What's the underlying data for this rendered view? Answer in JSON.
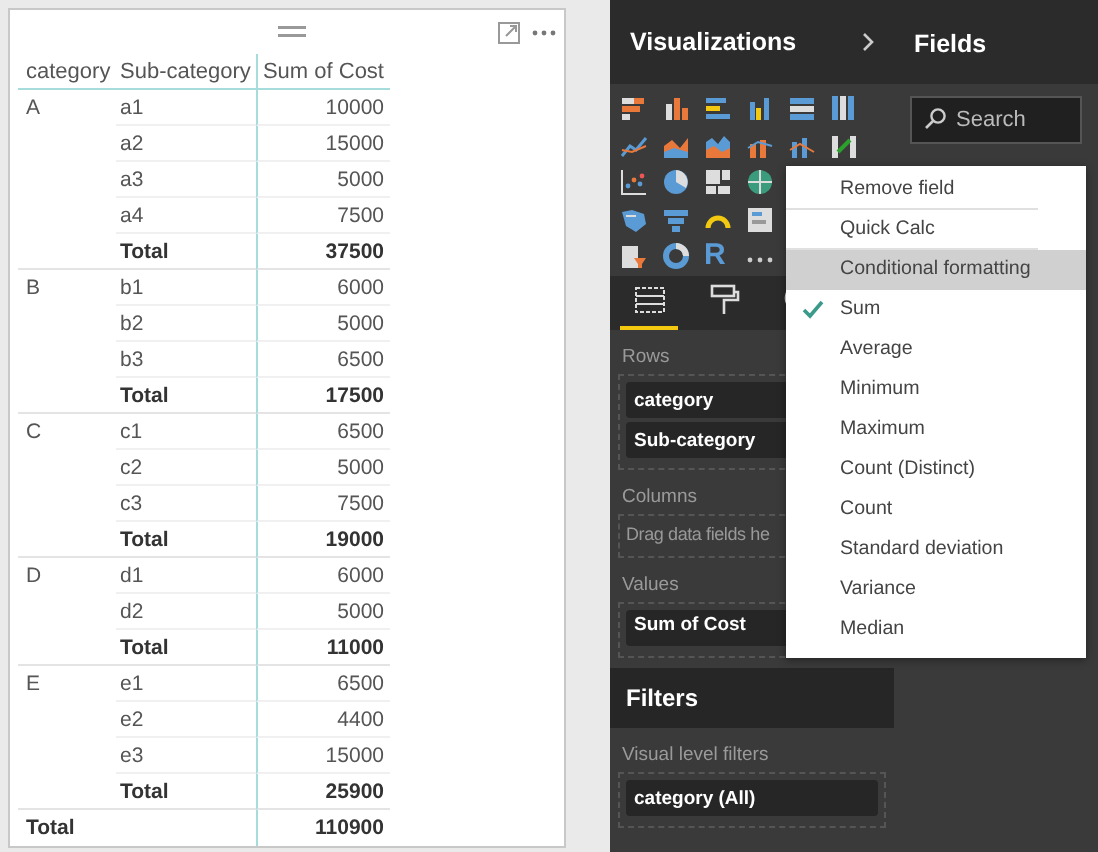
{
  "visual": {
    "columns": [
      "category",
      "Sub-category",
      "Sum of Cost"
    ],
    "groups": [
      {
        "category": "A",
        "rows": [
          {
            "sub": "a1",
            "value": "10000"
          },
          {
            "sub": "a2",
            "value": "15000"
          },
          {
            "sub": "a3",
            "value": "5000"
          },
          {
            "sub": "a4",
            "value": "7500"
          }
        ],
        "total_label": "Total",
        "total": "37500"
      },
      {
        "category": "B",
        "rows": [
          {
            "sub": "b1",
            "value": "6000"
          },
          {
            "sub": "b2",
            "value": "5000"
          },
          {
            "sub": "b3",
            "value": "6500"
          }
        ],
        "total_label": "Total",
        "total": "17500"
      },
      {
        "category": "C",
        "rows": [
          {
            "sub": "c1",
            "value": "6500"
          },
          {
            "sub": "c2",
            "value": "5000"
          },
          {
            "sub": "c3",
            "value": "7500"
          }
        ],
        "total_label": "Total",
        "total": "19000"
      },
      {
        "category": "D",
        "rows": [
          {
            "sub": "d1",
            "value": "6000"
          },
          {
            "sub": "d2",
            "value": "5000"
          }
        ],
        "total_label": "Total",
        "total": "11000"
      },
      {
        "category": "E",
        "rows": [
          {
            "sub": "e1",
            "value": "6500"
          },
          {
            "sub": "e2",
            "value": "4400"
          },
          {
            "sub": "e3",
            "value": "15000"
          }
        ],
        "total_label": "Total",
        "total": "25900"
      }
    ],
    "grand_total": {
      "label": "Total",
      "value": "110900"
    }
  },
  "visualizations": {
    "title": "Visualizations",
    "r_visual": "R",
    "tabs": [
      {
        "selected": true
      },
      {
        "selected": false
      },
      {
        "selected": false
      }
    ],
    "rows_label": "Rows",
    "rows": [
      "category",
      "Sub-category"
    ],
    "columns_label": "Columns",
    "columns_placeholder": "Drag data fields he",
    "values_label": "Values",
    "values": [
      "Sum of Cost"
    ]
  },
  "filters": {
    "title": "Filters",
    "subtitle": "Visual level filters",
    "items": [
      "category (All)"
    ]
  },
  "fields": {
    "title": "Fields",
    "search": {
      "placeholder": "Search"
    }
  },
  "context_menu": {
    "items": [
      {
        "label": "Remove field",
        "kind": "action",
        "highlighted": false
      },
      {
        "label": "Quick Calc",
        "kind": "action",
        "highlighted": false
      },
      {
        "label": "Conditional formatting",
        "kind": "action",
        "highlighted": true
      },
      {
        "label": "Sum",
        "kind": "aggregate",
        "checked": true
      },
      {
        "label": "Average",
        "kind": "aggregate",
        "checked": false
      },
      {
        "label": "Minimum",
        "kind": "aggregate",
        "checked": false
      },
      {
        "label": "Maximum",
        "kind": "aggregate",
        "checked": false
      },
      {
        "label": "Count (Distinct)",
        "kind": "aggregate",
        "checked": false
      },
      {
        "label": "Count",
        "kind": "aggregate",
        "checked": false
      },
      {
        "label": "Standard deviation",
        "kind": "aggregate",
        "checked": false
      },
      {
        "label": "Variance",
        "kind": "aggregate",
        "checked": false
      },
      {
        "label": "Median",
        "kind": "aggregate",
        "checked": false
      }
    ]
  }
}
